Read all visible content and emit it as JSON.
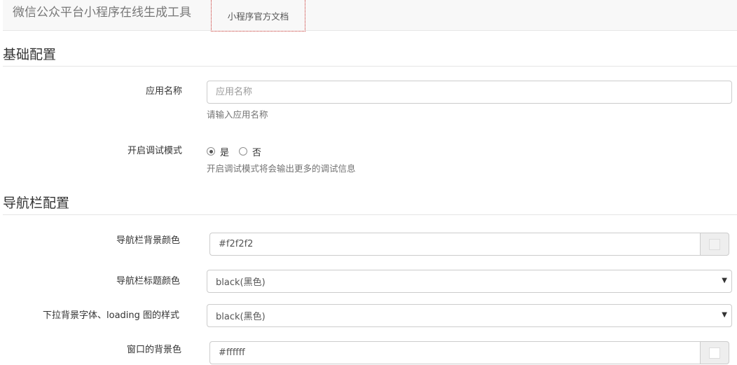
{
  "navbar": {
    "brand": "微信公众平台小程序在线生成工具",
    "tab_docs": "小程序官方文档"
  },
  "basic": {
    "title": "基础配置",
    "app_name": {
      "label": "应用名称",
      "placeholder": "应用名称",
      "value": "",
      "help": "请输入应用名称"
    },
    "debug": {
      "label": "开启调试模式",
      "options": [
        "是",
        "否"
      ],
      "selected": "是",
      "help": "开启调试模式将会输出更多的调试信息"
    }
  },
  "nav": {
    "title": "导航栏配置",
    "bg_color": {
      "label": "导航栏背景颜色",
      "value": "#f2f2f2",
      "swatch": "#f2f2f2"
    },
    "title_color": {
      "label": "导航栏标题颜色",
      "selected": "black(黑色)"
    },
    "pull_style": {
      "label": "下拉背景字体、loading 图的样式",
      "selected": "black(黑色)"
    },
    "window_bg": {
      "label": "窗口的背景色",
      "value": "#ffffff",
      "swatch": "#ffffff"
    }
  },
  "icons": {
    "caret": "caret-down-icon"
  }
}
